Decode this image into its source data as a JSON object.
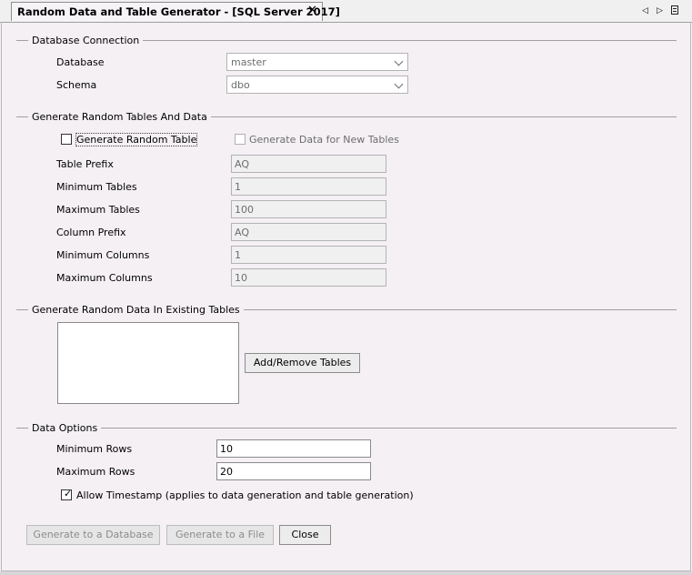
{
  "tab": {
    "title": "Random Data and Table Generator - [SQL Server 2017]",
    "close": "✕"
  },
  "icons": {
    "prev": "◁",
    "next": "▷",
    "menu": "menu-icon"
  },
  "connection": {
    "section": "Database Connection",
    "database_label": "Database",
    "database_value": "master",
    "schema_label": "Schema",
    "schema_value": "dbo"
  },
  "random_tables": {
    "section": "Generate Random Tables And Data",
    "generate_random_table": "Generate Random Table",
    "generate_data_new_tables": "Generate Data for New Tables",
    "fields": [
      {
        "label": "Table Prefix",
        "value": "AQ"
      },
      {
        "label": "Minimum Tables",
        "value": "1"
      },
      {
        "label": "Maximum Tables",
        "value": "100"
      },
      {
        "label": "Column Prefix",
        "value": "AQ"
      },
      {
        "label": "Minimum Columns",
        "value": "1"
      },
      {
        "label": "Maximum Columns",
        "value": "10"
      }
    ]
  },
  "existing": {
    "section": "Generate Random Data In Existing Tables",
    "add_remove_button": "Add/Remove Tables"
  },
  "data_options": {
    "section": "Data Options",
    "min_rows_label": "Minimum Rows",
    "min_rows_value": "10",
    "max_rows_label": "Maximum Rows",
    "max_rows_value": "20",
    "allow_timestamp": "Allow Timestamp (applies to data generation and table generation)",
    "allow_timestamp_checked": true,
    "check_mark": "✓"
  },
  "buttons": {
    "generate_db": "Generate to a Database",
    "generate_file": "Generate to a File",
    "close": "Close"
  }
}
